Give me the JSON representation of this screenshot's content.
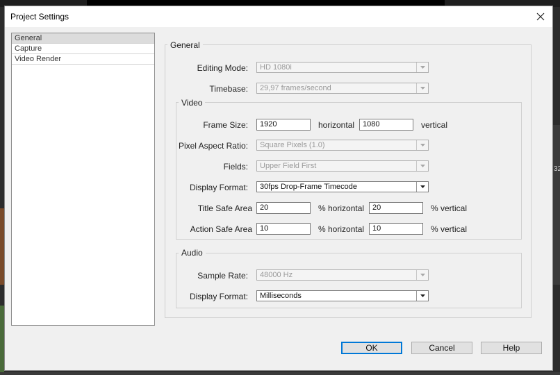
{
  "window": {
    "title": "Project Settings"
  },
  "background": {
    "ruler_number": "32"
  },
  "nav": {
    "items": [
      {
        "label": "General",
        "selected": true
      },
      {
        "label": "Capture",
        "selected": false
      },
      {
        "label": "Video Render",
        "selected": false
      }
    ]
  },
  "general": {
    "legend": "General",
    "editing_mode": {
      "label": "Editing Mode:",
      "value": "HD 1080i"
    },
    "timebase": {
      "label": "Timebase:",
      "value": "29,97 frames/second"
    }
  },
  "video": {
    "legend": "Video",
    "frame_size": {
      "label": "Frame Size:",
      "horizontal": "1920",
      "horizontal_unit": "horizontal",
      "vertical": "1080",
      "vertical_unit": "vertical"
    },
    "pixel_aspect_ratio": {
      "label": "Pixel Aspect Ratio:",
      "value": "Square Pixels (1.0)"
    },
    "fields": {
      "label": "Fields:",
      "value": "Upper Field First"
    },
    "display_format": {
      "label": "Display Format:",
      "value": "30fps Drop-Frame Timecode"
    },
    "title_safe_area": {
      "label": "Title Safe Area",
      "horizontal": "20",
      "horizontal_unit": "% horizontal",
      "vertical": "20",
      "vertical_unit": "% vertical"
    },
    "action_safe_area": {
      "label": "Action Safe Area",
      "horizontal": "10",
      "horizontal_unit": "% horizontal",
      "vertical": "10",
      "vertical_unit": "% vertical"
    }
  },
  "audio": {
    "legend": "Audio",
    "sample_rate": {
      "label": "Sample Rate:",
      "value": "48000 Hz"
    },
    "display_format": {
      "label": "Display Format:",
      "value": "Milliseconds"
    }
  },
  "buttons": {
    "ok": "OK",
    "cancel": "Cancel",
    "help": "Help"
  },
  "colors": {
    "accent": "#0078d7",
    "dialog_bg": "#f0f0f0",
    "titlebar_bg": "#ffffff"
  }
}
